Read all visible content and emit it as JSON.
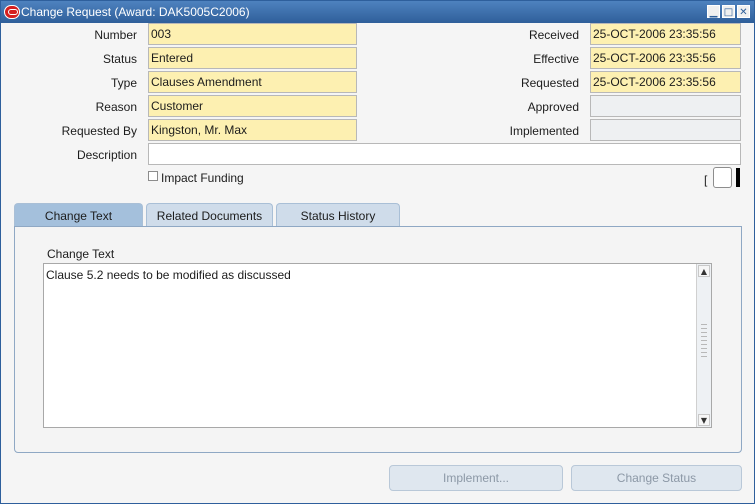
{
  "window": {
    "title": "Change Request (Award: DAK5005C2006)",
    "controls": {
      "minimize": "▁",
      "maximize": "□",
      "close": "✕"
    }
  },
  "form": {
    "number": {
      "label": "Number",
      "value": "003"
    },
    "status": {
      "label": "Status",
      "value": "Entered"
    },
    "type": {
      "label": "Type",
      "value": "Clauses Amendment"
    },
    "reason": {
      "label": "Reason",
      "value": "Customer"
    },
    "requested_by": {
      "label": "Requested By",
      "value": "Kingston, Mr. Max"
    },
    "description": {
      "label": "Description",
      "value": ""
    },
    "received": {
      "label": "Received",
      "value": "25-OCT-2006 23:35:56"
    },
    "effective": {
      "label": "Effective",
      "value": "25-OCT-2006 23:35:56"
    },
    "requested": {
      "label": "Requested",
      "value": "25-OCT-2006 23:35:56"
    },
    "approved": {
      "label": "Approved",
      "value": ""
    },
    "implemented": {
      "label": "Implemented",
      "value": ""
    },
    "impact_funding": {
      "label": "Impact Funding",
      "checked": false
    },
    "flex_bracket": "["
  },
  "tabs": [
    {
      "label": "Change Text",
      "active": true
    },
    {
      "label": "Related Documents",
      "active": false
    },
    {
      "label": "Status History",
      "active": false
    }
  ],
  "change_text": {
    "label": "Change Text",
    "value": "Clause 5.2 needs to be modified as discussed"
  },
  "buttons": {
    "implement": "Implement...",
    "change_status": "Change Status"
  },
  "colors": {
    "titlebar": "#3c6ea9",
    "required_field": "#fdf0b1",
    "tab_active": "#a4c0dc",
    "tab_inactive": "#cfdcea"
  }
}
